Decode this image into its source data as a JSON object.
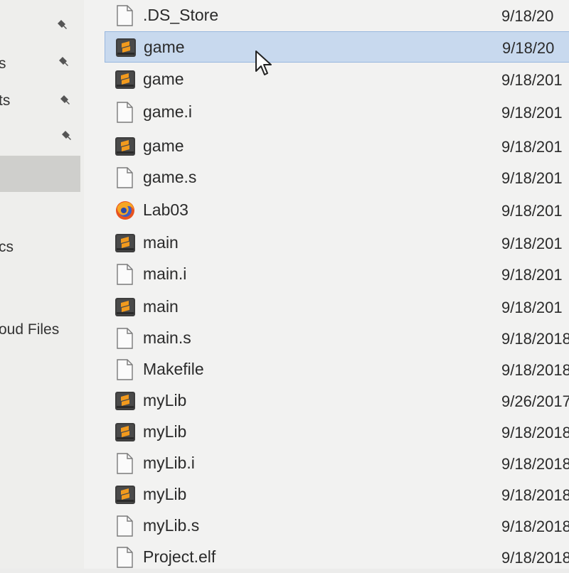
{
  "nav": {
    "items": [
      {
        "label": "s",
        "pinned": true
      },
      {
        "label": "ts",
        "pinned": true
      },
      {
        "label": "",
        "pinned": true
      },
      {
        "label": "",
        "pinned": true,
        "selected": true
      },
      {
        "label": "cs",
        "pinned": false
      },
      {
        "label": "oud Files",
        "pinned": false
      }
    ]
  },
  "files": [
    {
      "name": ".DS_Store",
      "date": "9/18/20",
      "icon": "blank-file-icon"
    },
    {
      "name": "game",
      "date": "9/18/20",
      "icon": "sublime-file-icon",
      "selected": true
    },
    {
      "name": "game",
      "date": "9/18/201",
      "icon": "sublime-file-icon"
    },
    {
      "name": "game.i",
      "date": "9/18/201",
      "icon": "blank-file-icon"
    },
    {
      "name": "game",
      "date": "9/18/201",
      "icon": "sublime-file-icon"
    },
    {
      "name": "game.s",
      "date": "9/18/201",
      "icon": "blank-file-icon"
    },
    {
      "name": "Lab03",
      "date": "9/18/201",
      "icon": "firefox-icon"
    },
    {
      "name": "main",
      "date": "9/18/201",
      "icon": "sublime-file-icon"
    },
    {
      "name": "main.i",
      "date": "9/18/201",
      "icon": "blank-file-icon"
    },
    {
      "name": "main",
      "date": "9/18/201",
      "icon": "sublime-file-icon"
    },
    {
      "name": "main.s",
      "date": "9/18/2018",
      "icon": "blank-file-icon"
    },
    {
      "name": "Makefile",
      "date": "9/18/2018",
      "icon": "blank-file-icon"
    },
    {
      "name": "myLib",
      "date": "9/26/2017",
      "icon": "sublime-file-icon"
    },
    {
      "name": "myLib",
      "date": "9/18/2018",
      "icon": "sublime-file-icon"
    },
    {
      "name": "myLib.i",
      "date": "9/18/2018",
      "icon": "blank-file-icon"
    },
    {
      "name": "myLib",
      "date": "9/18/2018",
      "icon": "sublime-file-icon"
    },
    {
      "name": "myLib.s",
      "date": "9/18/2018",
      "icon": "blank-file-icon"
    },
    {
      "name": "Project.elf",
      "date": "9/18/2018",
      "icon": "blank-file-icon"
    }
  ],
  "colors": {
    "selection": "#c8d9ee",
    "selection_border": "#98b7de",
    "nav_selected": "#cfcfcc",
    "sublime_orange": "#f29a1d"
  }
}
